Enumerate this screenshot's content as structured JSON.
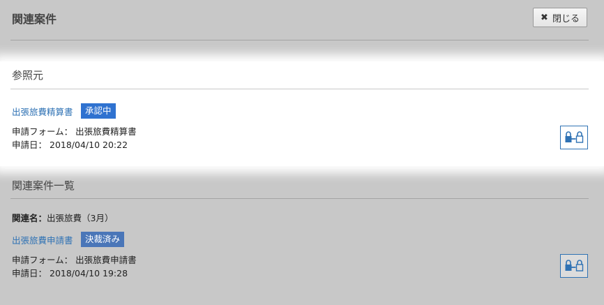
{
  "header": {
    "title": "関連案件",
    "close_label": "閉じる"
  },
  "reference_section": {
    "title": "参照元",
    "item": {
      "doc_name": "出張旅費精算書",
      "status": "承認中",
      "status_color": "#2f72d0",
      "form_label": "申請フォーム：",
      "form_value": "出張旅費精算書",
      "date_label": "申請日：",
      "date_value": "2018/04/10 20:22"
    }
  },
  "related_section": {
    "title": "関連案件一覧",
    "relation_label": "関連名：",
    "relation_value": "出張旅費（3月）",
    "item": {
      "doc_name": "出張旅費申請書",
      "status": "決裁済み",
      "status_color": "#4a76b8",
      "form_label": "申請フォーム：",
      "form_value": "出張旅費申請書",
      "date_label": "申請日：",
      "date_value": "2018/04/10 19:28"
    }
  }
}
